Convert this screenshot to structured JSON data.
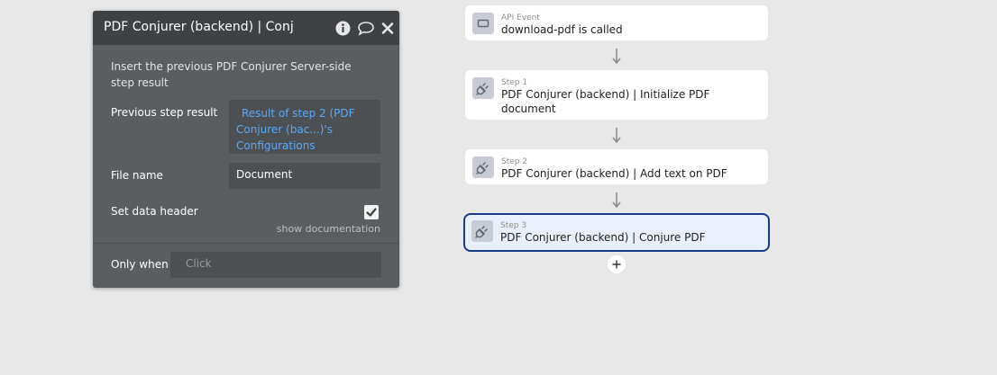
{
  "panel": {
    "title": "PDF Conjurer (backend) | Conjure PDF",
    "description": "Insert the previous PDF Conjurer Server-side step result",
    "rows": {
      "previous_step_label": "Previous step result",
      "previous_step_value": "Result of step 2 (PDF Conjurer (bac...)'s Configurations",
      "file_name_label": "File name",
      "file_name_value": "Document",
      "set_data_header_label": "Set data header",
      "set_data_header_checked": true
    },
    "show_documentation": "show documentation",
    "only_when_label": "Only when",
    "only_when_placeholder": "Click",
    "colors": {
      "header": "#3f4245",
      "body": "#5b5e61",
      "link": "#5aa8f5"
    },
    "icons": [
      "info-icon",
      "comment-icon",
      "close-icon"
    ]
  },
  "workflow": {
    "event": {
      "kicker": "API Event",
      "title": "download-pdf is called",
      "icon": "api-event-icon"
    },
    "steps": [
      {
        "kicker": "Step 1",
        "title": "PDF Conjurer (backend) | Initialize PDF document",
        "icon": "plug-icon"
      },
      {
        "kicker": "Step 2",
        "title": "PDF Conjurer (backend) | Add text on PDF",
        "icon": "plug-icon"
      },
      {
        "kicker": "Step 3",
        "title": "PDF Conjurer (backend) | Conjure PDF",
        "icon": "plug-icon",
        "selected": true
      }
    ],
    "add_icon": "plus-icon",
    "selected_border_color": "#1b3a86"
  }
}
